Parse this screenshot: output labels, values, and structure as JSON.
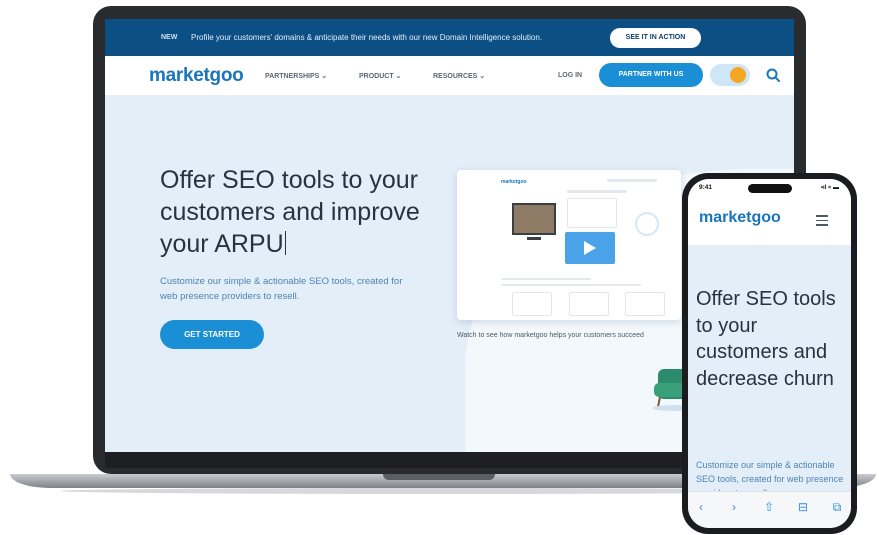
{
  "announcement": {
    "badge": "NEW",
    "message": "Profile your customers' domains & anticipate their needs with our new Domain Intelligence solution.",
    "cta": "SEE IT IN ACTION"
  },
  "nav": {
    "logo": "marketgoo",
    "items": [
      {
        "label": "PARTNERSHIPS ⌄"
      },
      {
        "label": "PRODUCT ⌄"
      },
      {
        "label": "RESOURCES ⌄"
      }
    ],
    "login": "LOG IN",
    "partner_button": "PARTNER WITH US"
  },
  "hero": {
    "title": "Offer SEO tools to your customers and improve your ARPU",
    "subtitle": "Customize our simple & actionable  SEO  tools, created for web presence providers to resell.",
    "cta": "GET STARTED"
  },
  "video": {
    "logo": "marketgoo",
    "caption": "Watch to see how marketgoo helps your customers succeed"
  },
  "phone": {
    "time": "9:41",
    "status_icons": "•ıl ≈ ▬",
    "logo": "marketgoo",
    "title": "Offer SEO tools to your customers and decrease churn",
    "subtitle": "Customize our simple & actionable  SEO  tools, created for web presence providers to resell.",
    "toolbar": {
      "back": "‹",
      "forward": "›",
      "share": "⇧",
      "bookmarks": "⊟",
      "tabs": "⧉"
    }
  },
  "colors": {
    "brand": "#1b75bb",
    "button": "#1b8fd6",
    "announce_bg": "#0c4f84",
    "hero_bg": "#e4eef8"
  }
}
